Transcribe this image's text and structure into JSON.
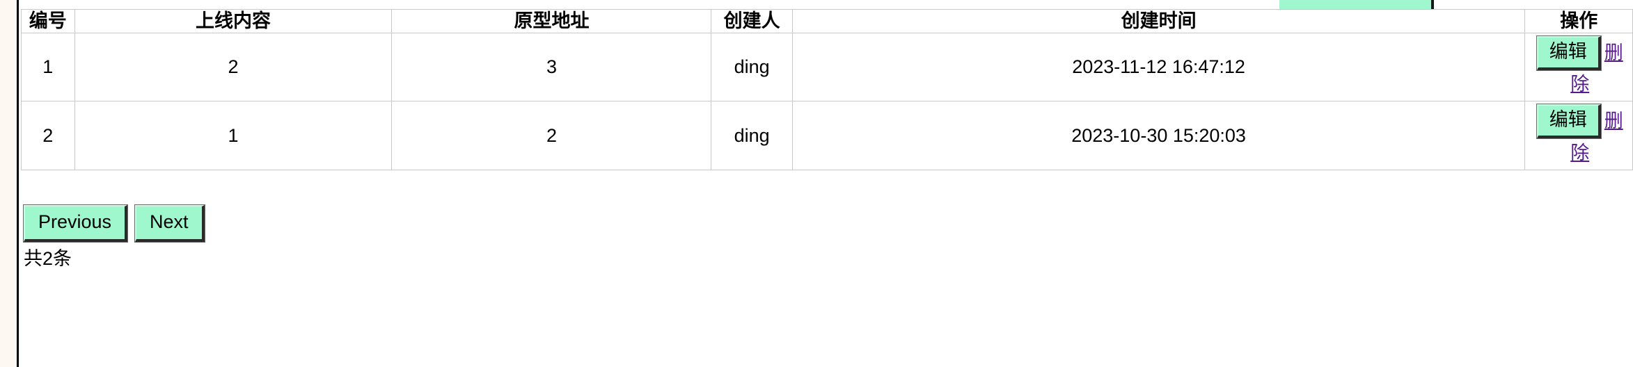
{
  "top_button": {
    "label": ""
  },
  "table": {
    "columns": [
      {
        "key": "id",
        "label": "编号"
      },
      {
        "key": "content",
        "label": "上线内容"
      },
      {
        "key": "proto",
        "label": "原型地址"
      },
      {
        "key": "creator",
        "label": "创建人"
      },
      {
        "key": "time",
        "label": "创建时间"
      },
      {
        "key": "ops",
        "label": "操作"
      }
    ],
    "rows": [
      {
        "id": "1",
        "content": "2",
        "proto": "3",
        "creator": "ding",
        "time": "2023-11-12 16:47:12",
        "edit_label": "编辑",
        "delete_label": "删除"
      },
      {
        "id": "2",
        "content": "1",
        "proto": "2",
        "creator": "ding",
        "time": "2023-10-30 15:20:03",
        "edit_label": "编辑",
        "delete_label": "删除"
      }
    ]
  },
  "pager": {
    "previous_label": "Previous",
    "next_label": "Next",
    "total_label": "共2条"
  },
  "colors": {
    "button_green": "#9ef7cd",
    "link_purple": "#551a8b",
    "gutter_cream": "#fdf8f2",
    "border_gray": "#c8c8c8"
  }
}
